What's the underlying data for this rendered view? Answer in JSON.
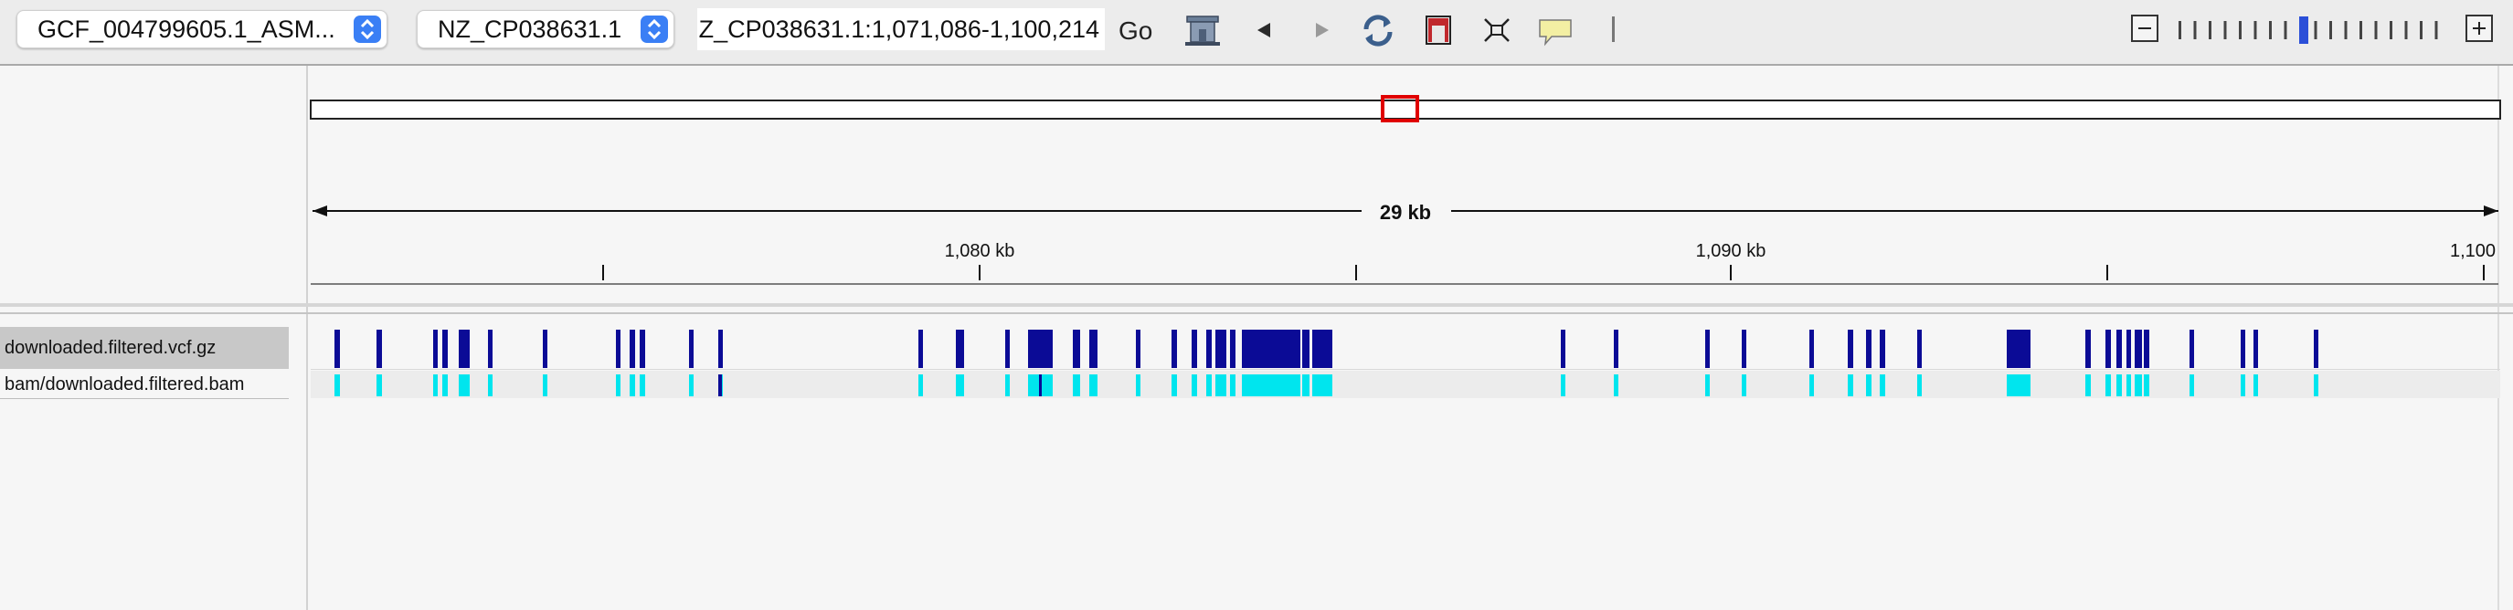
{
  "toolbar": {
    "genome_label": "GCF_004799605.1_ASM...",
    "chromosome_label": "NZ_CP038631.1",
    "locus_value": "NZ_CP038631.1:1,071,086-1,100,214",
    "go_label": "Go",
    "icons": [
      "home-icon",
      "back-icon",
      "forward-icon",
      "refresh-icon",
      "region-icon",
      "fit-icon",
      "popup-icon"
    ],
    "zoom_out_symbol": "−",
    "zoom_in_symbol": "+"
  },
  "ruler": {
    "span_label": "29 kb",
    "tick_labels": [
      "1,080 kb",
      "1,090 kb",
      "1,100"
    ]
  },
  "tracks": [
    {
      "label": "downloaded.filtered.vcf.gz"
    },
    {
      "label": "bam/downloaded.filtered.bam"
    }
  ],
  "colors": {
    "variant": "#0b0b96",
    "coverage": "#00e5ee",
    "region_box": "#e00000",
    "zoom_active": "#2b4fd8"
  }
}
